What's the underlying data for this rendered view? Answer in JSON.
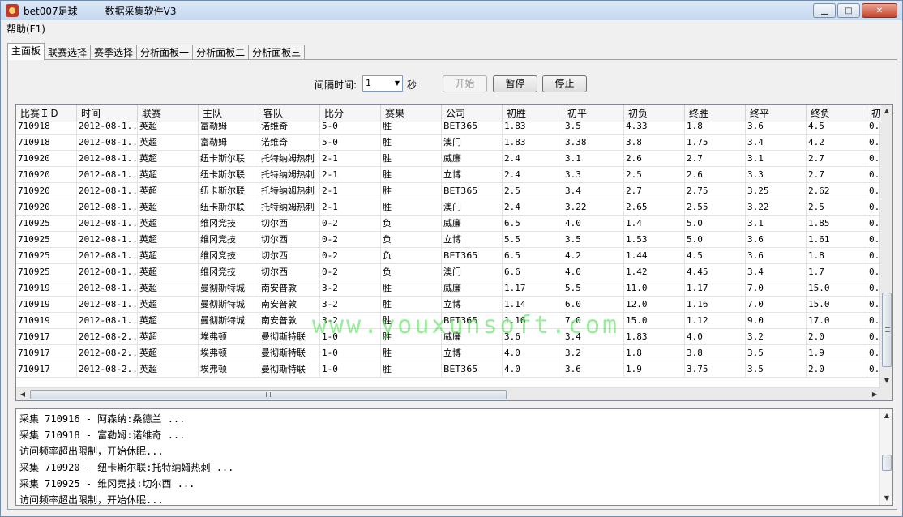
{
  "window": {
    "app_name": "bet007足球",
    "subtitle": "数据采集软件V3"
  },
  "menu": {
    "help": "帮助(F1)"
  },
  "tabs": [
    "主面板",
    "联赛选择",
    "赛季选择",
    "分析面板一",
    "分析面板二",
    "分析面板三"
  ],
  "controls": {
    "interval_label": "间隔时间:",
    "interval_value": "1",
    "seconds_label": "秒",
    "start": "开始",
    "pause": "暂停",
    "stop": "停止"
  },
  "table": {
    "columns": [
      "比赛ＩＤ",
      "时间",
      "联赛",
      "主队",
      "客队",
      "比分",
      "赛果",
      "公司",
      "初胜",
      "初平",
      "初负",
      "终胜",
      "终平",
      "终负",
      "初"
    ],
    "rows": [
      [
        "710918",
        "2012-08-1...",
        "英超",
        "富勒姆",
        "诺维奇",
        "5-0",
        "胜",
        "BET365",
        "1.83",
        "3.5",
        "4.33",
        "1.8",
        "3.6",
        "4.5",
        "0."
      ],
      [
        "710918",
        "2012-08-1...",
        "英超",
        "富勒姆",
        "诺维奇",
        "5-0",
        "胜",
        "澳门",
        "1.83",
        "3.38",
        "3.8",
        "1.75",
        "3.4",
        "4.2",
        "0."
      ],
      [
        "710920",
        "2012-08-1...",
        "英超",
        "纽卡斯尔联",
        "托特纳姆热刺",
        "2-1",
        "胜",
        "威廉",
        "2.4",
        "3.1",
        "2.6",
        "2.7",
        "3.1",
        "2.7",
        "0."
      ],
      [
        "710920",
        "2012-08-1...",
        "英超",
        "纽卡斯尔联",
        "托特纳姆热刺",
        "2-1",
        "胜",
        "立博",
        "2.4",
        "3.3",
        "2.5",
        "2.6",
        "3.3",
        "2.7",
        "0."
      ],
      [
        "710920",
        "2012-08-1...",
        "英超",
        "纽卡斯尔联",
        "托特纳姆热刺",
        "2-1",
        "胜",
        "BET365",
        "2.5",
        "3.4",
        "2.7",
        "2.75",
        "3.25",
        "2.62",
        "0."
      ],
      [
        "710920",
        "2012-08-1...",
        "英超",
        "纽卡斯尔联",
        "托特纳姆热刺",
        "2-1",
        "胜",
        "澳门",
        "2.4",
        "3.22",
        "2.65",
        "2.55",
        "3.22",
        "2.5",
        "0."
      ],
      [
        "710925",
        "2012-08-1...",
        "英超",
        "维冈竞技",
        "切尔西",
        "0-2",
        "负",
        "威廉",
        "6.5",
        "4.0",
        "1.4",
        "5.0",
        "3.1",
        "1.85",
        "0."
      ],
      [
        "710925",
        "2012-08-1...",
        "英超",
        "维冈竞技",
        "切尔西",
        "0-2",
        "负",
        "立博",
        "5.5",
        "3.5",
        "1.53",
        "5.0",
        "3.6",
        "1.61",
        "0."
      ],
      [
        "710925",
        "2012-08-1...",
        "英超",
        "维冈竞技",
        "切尔西",
        "0-2",
        "负",
        "BET365",
        "6.5",
        "4.2",
        "1.44",
        "4.5",
        "3.6",
        "1.8",
        "0."
      ],
      [
        "710925",
        "2012-08-1...",
        "英超",
        "维冈竞技",
        "切尔西",
        "0-2",
        "负",
        "澳门",
        "6.6",
        "4.0",
        "1.42",
        "4.45",
        "3.4",
        "1.7",
        "0."
      ],
      [
        "710919",
        "2012-08-1...",
        "英超",
        "曼彻斯特城",
        "南安普敦",
        "3-2",
        "胜",
        "威廉",
        "1.17",
        "5.5",
        "11.0",
        "1.17",
        "7.0",
        "15.0",
        "0."
      ],
      [
        "710919",
        "2012-08-1...",
        "英超",
        "曼彻斯特城",
        "南安普敦",
        "3-2",
        "胜",
        "立博",
        "1.14",
        "6.0",
        "12.0",
        "1.16",
        "7.0",
        "15.0",
        "0."
      ],
      [
        "710919",
        "2012-08-1...",
        "英超",
        "曼彻斯特城",
        "南安普敦",
        "3-2",
        "胜",
        "BET365",
        "1.16",
        "7.0",
        "15.0",
        "1.12",
        "9.0",
        "17.0",
        "0."
      ],
      [
        "710917",
        "2012-08-2...",
        "英超",
        "埃弗顿",
        "曼彻斯特联",
        "1-0",
        "胜",
        "威廉",
        "3.6",
        "3.4",
        "1.83",
        "4.0",
        "3.2",
        "2.0",
        "0."
      ],
      [
        "710917",
        "2012-08-2...",
        "英超",
        "埃弗顿",
        "曼彻斯特联",
        "1-0",
        "胜",
        "立博",
        "4.0",
        "3.2",
        "1.8",
        "3.8",
        "3.5",
        "1.9",
        "0."
      ],
      [
        "710917",
        "2012-08-2...",
        "英超",
        "埃弗顿",
        "曼彻斯特联",
        "1-0",
        "胜",
        "BET365",
        "4.0",
        "3.6",
        "1.9",
        "3.75",
        "3.5",
        "2.0",
        "0."
      ]
    ]
  },
  "watermark": "www.youxunsoft.com",
  "log": [
    "采集 710916 - 阿森纳:桑德兰 ...",
    "采集 710918 - 富勒姆:诺维奇 ...",
    "访问频率超出限制，开始休眠...",
    "采集 710920 - 纽卡斯尔联:托特纳姆热刺 ...",
    "采集 710925 - 维冈竞技:切尔西 ...",
    "访问频率超出限制，开始休眠..."
  ],
  "icons": {
    "app": "app-ball-icon",
    "minimize": "minimize-icon",
    "maximize": "maximize-icon",
    "close": "close-icon",
    "dropdown": "chevron-down-icon"
  },
  "colors": {
    "titlebar": "#c5d8ef",
    "close": "#c7442b",
    "watermark": "#46dc46"
  }
}
